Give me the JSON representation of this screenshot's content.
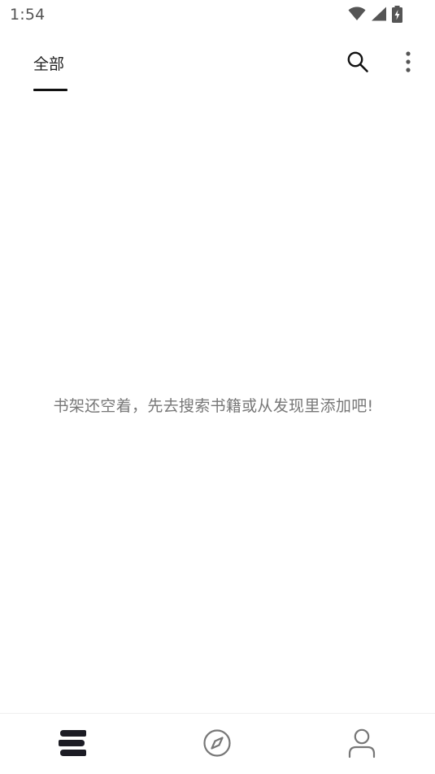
{
  "status_bar": {
    "time": "1:54",
    "icons": [
      "wifi-icon",
      "cellular-signal-icon",
      "battery-charging-icon"
    ]
  },
  "app_bar": {
    "tabs": [
      {
        "label": "全部",
        "selected": true
      }
    ],
    "actions": [
      "search-icon",
      "more-vert-icon"
    ]
  },
  "bookshelf": {
    "empty_message": "书架还空着，先去搜索书籍或从发现里添加吧!"
  },
  "bottom_nav": {
    "items": [
      {
        "icon": "bookshelf-icon",
        "selected": true
      },
      {
        "icon": "compass-icon",
        "selected": false
      },
      {
        "icon": "person-icon",
        "selected": false
      }
    ]
  },
  "colors": {
    "primary_text": "#222222",
    "secondary_text": "#777777",
    "indicator": "#111111",
    "background": "#ffffff"
  }
}
